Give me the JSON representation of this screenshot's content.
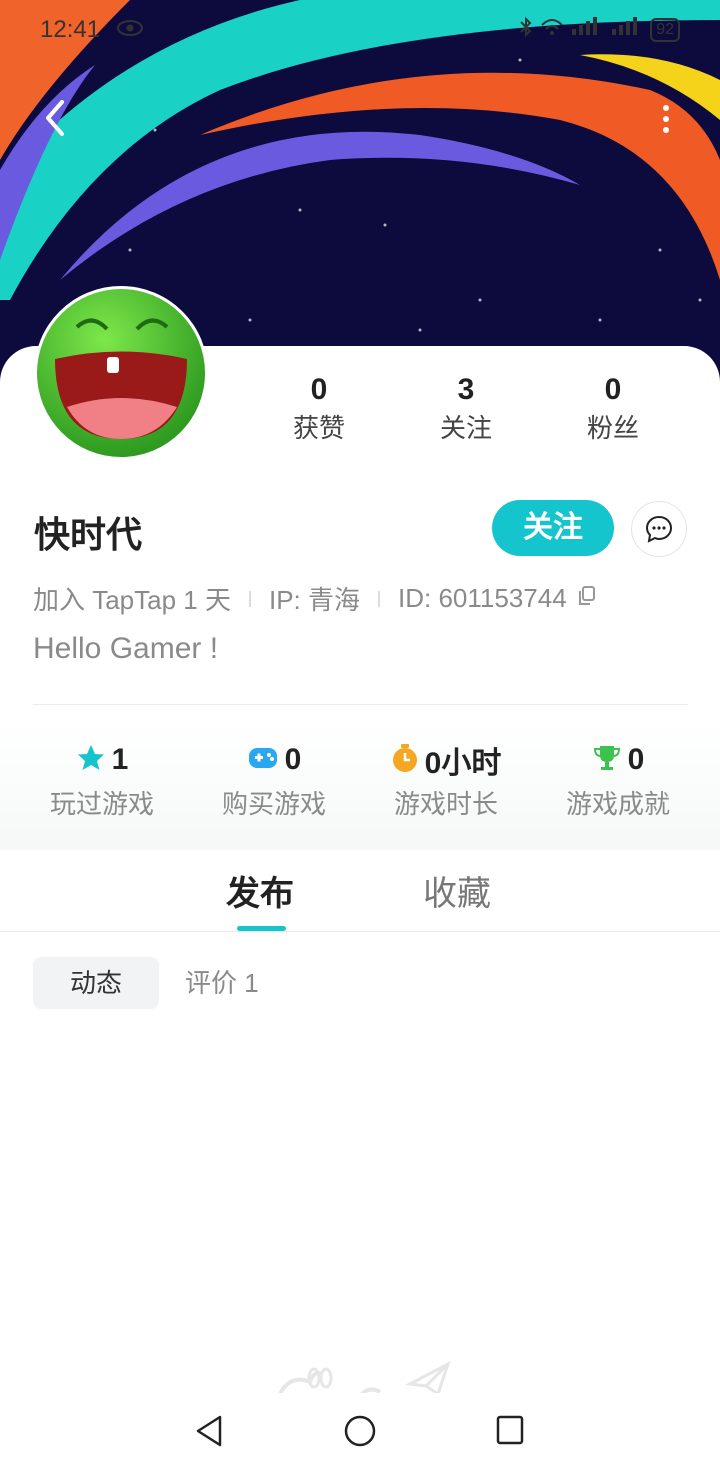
{
  "status_bar": {
    "time": "12:41",
    "battery": "92"
  },
  "profile": {
    "name": "快时代",
    "follow_label": "关注",
    "join_info": "加入 TapTap 1 天",
    "ip_info": "IP:  青海",
    "id_info": "ID:  601153744",
    "bio": "Hello Gamer !"
  },
  "stats": [
    {
      "value": "0",
      "label": "获赞"
    },
    {
      "value": "3",
      "label": "关注"
    },
    {
      "value": "0",
      "label": "粉丝"
    }
  ],
  "game_stats": [
    {
      "icon": "star-icon",
      "value": "1",
      "label": "玩过游戏",
      "color": "#15c5ce"
    },
    {
      "icon": "gamepad-icon",
      "value": "0",
      "label": "购买游戏",
      "color": "#2aa7f0"
    },
    {
      "icon": "stopwatch-icon",
      "value": "0小时",
      "label": "游戏时长",
      "color": "#f5a623"
    },
    {
      "icon": "trophy-icon",
      "value": "0",
      "label": "游戏成就",
      "color": "#3ec24f"
    }
  ],
  "tabs": [
    {
      "label": "发布",
      "active": true
    },
    {
      "label": "收藏",
      "active": false
    }
  ],
  "subtabs": [
    {
      "label": "动态",
      "active": true
    },
    {
      "label": "评价 1",
      "active": false
    }
  ],
  "colors": {
    "accent": "#15c5ce",
    "banner_bg": "#0d0b3d"
  }
}
